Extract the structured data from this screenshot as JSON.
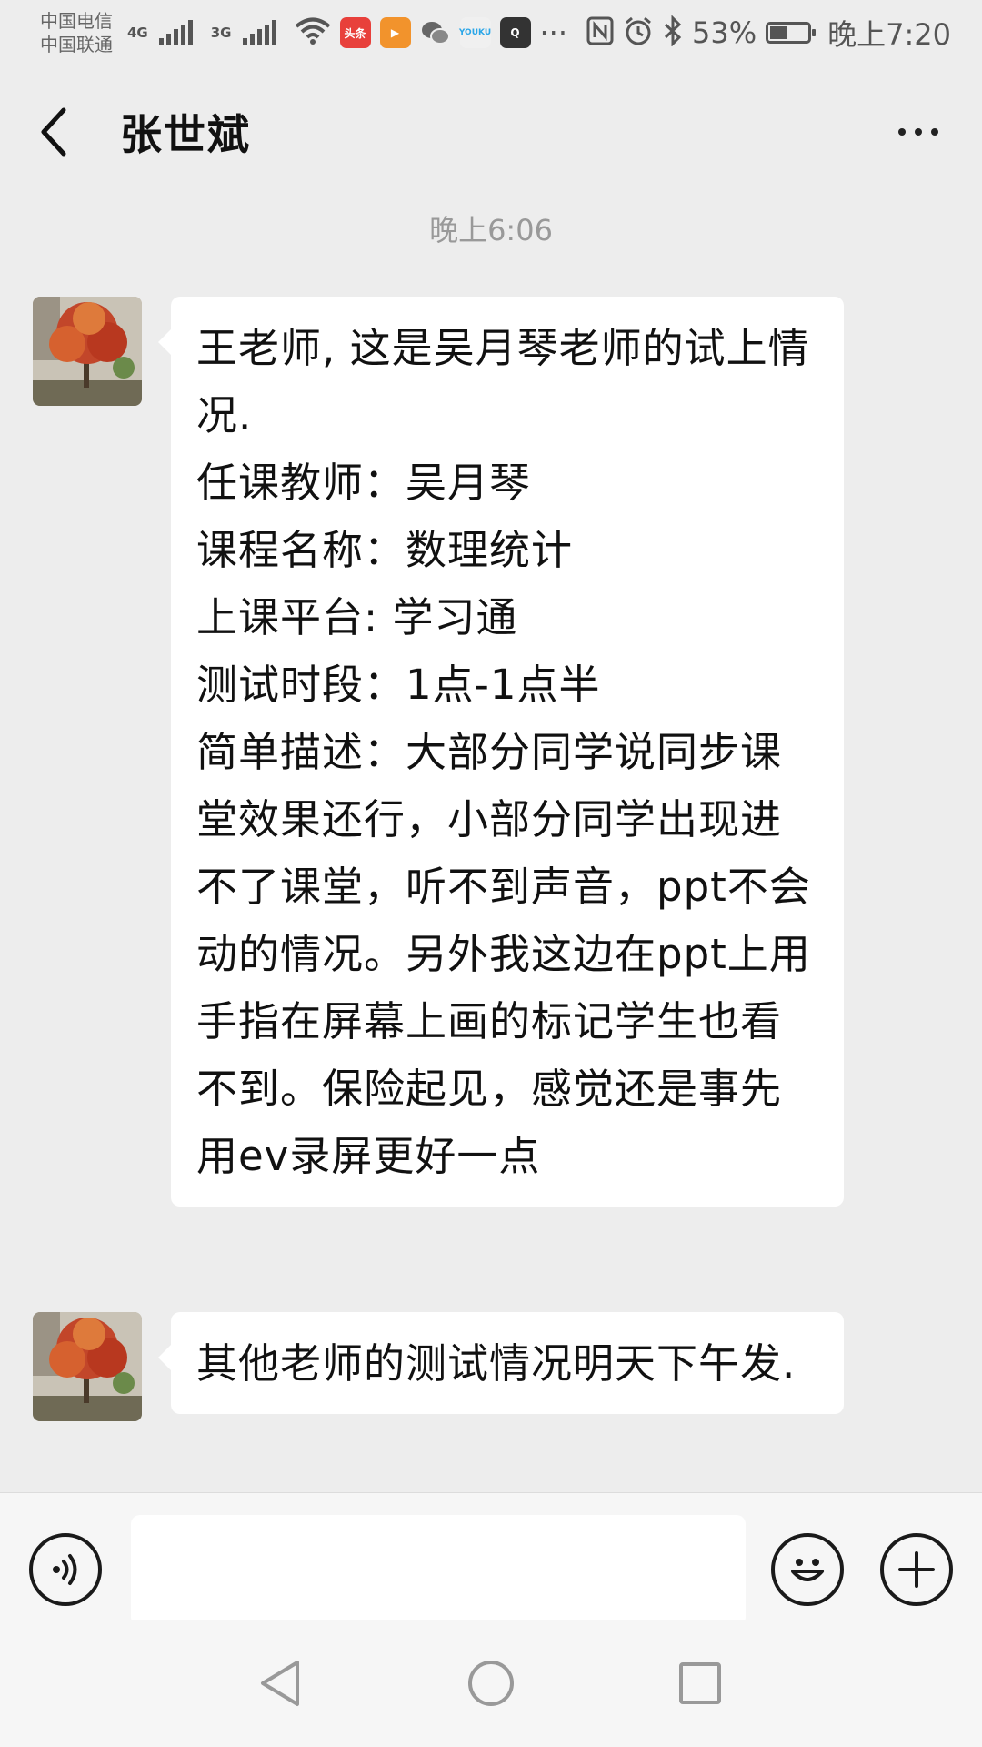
{
  "status_bar": {
    "carrier1": "中国电信",
    "carrier2": "中国联通",
    "net1": "4G",
    "net2": "3G",
    "more": "···",
    "battery": "53%",
    "battery_level": 0.53,
    "time": "晚上7:20",
    "app_icons": [
      {
        "name": "toutiao",
        "label": "头条",
        "color": "#e8403b"
      },
      {
        "name": "video-play",
        "label": "▶",
        "color": "#f2932c"
      },
      {
        "name": "wechat",
        "label": "",
        "color": "#666666"
      },
      {
        "name": "youku",
        "label": "YOUKU",
        "color": "#2aa6e8"
      },
      {
        "name": "tv",
        "label": "Q",
        "color": "#333333"
      }
    ]
  },
  "header": {
    "title": "张世斌"
  },
  "chat": {
    "timestamp": "晚上6:06",
    "messages": [
      {
        "lines": [
          "王老师, 这是吴月琴老师的试上情况.",
          "任课教师：吴月琴",
          "课程名称：数理统计",
          "上课平台: 学习通",
          "测试时段：1点-1点半",
          "简单描述：大部分同学说同步课堂效果还行，小部分同学出现进不了课堂，听不到声音，ppt不会动的情况。另外我这边在ppt上用手指在屏幕上画的标记学生也看不到。保险起见，感觉还是事先用ev录屏更好一点"
        ]
      },
      {
        "lines": [
          "其他老师的测试情况明天下午发."
        ]
      }
    ]
  },
  "input": {
    "value": "",
    "placeholder": ""
  }
}
